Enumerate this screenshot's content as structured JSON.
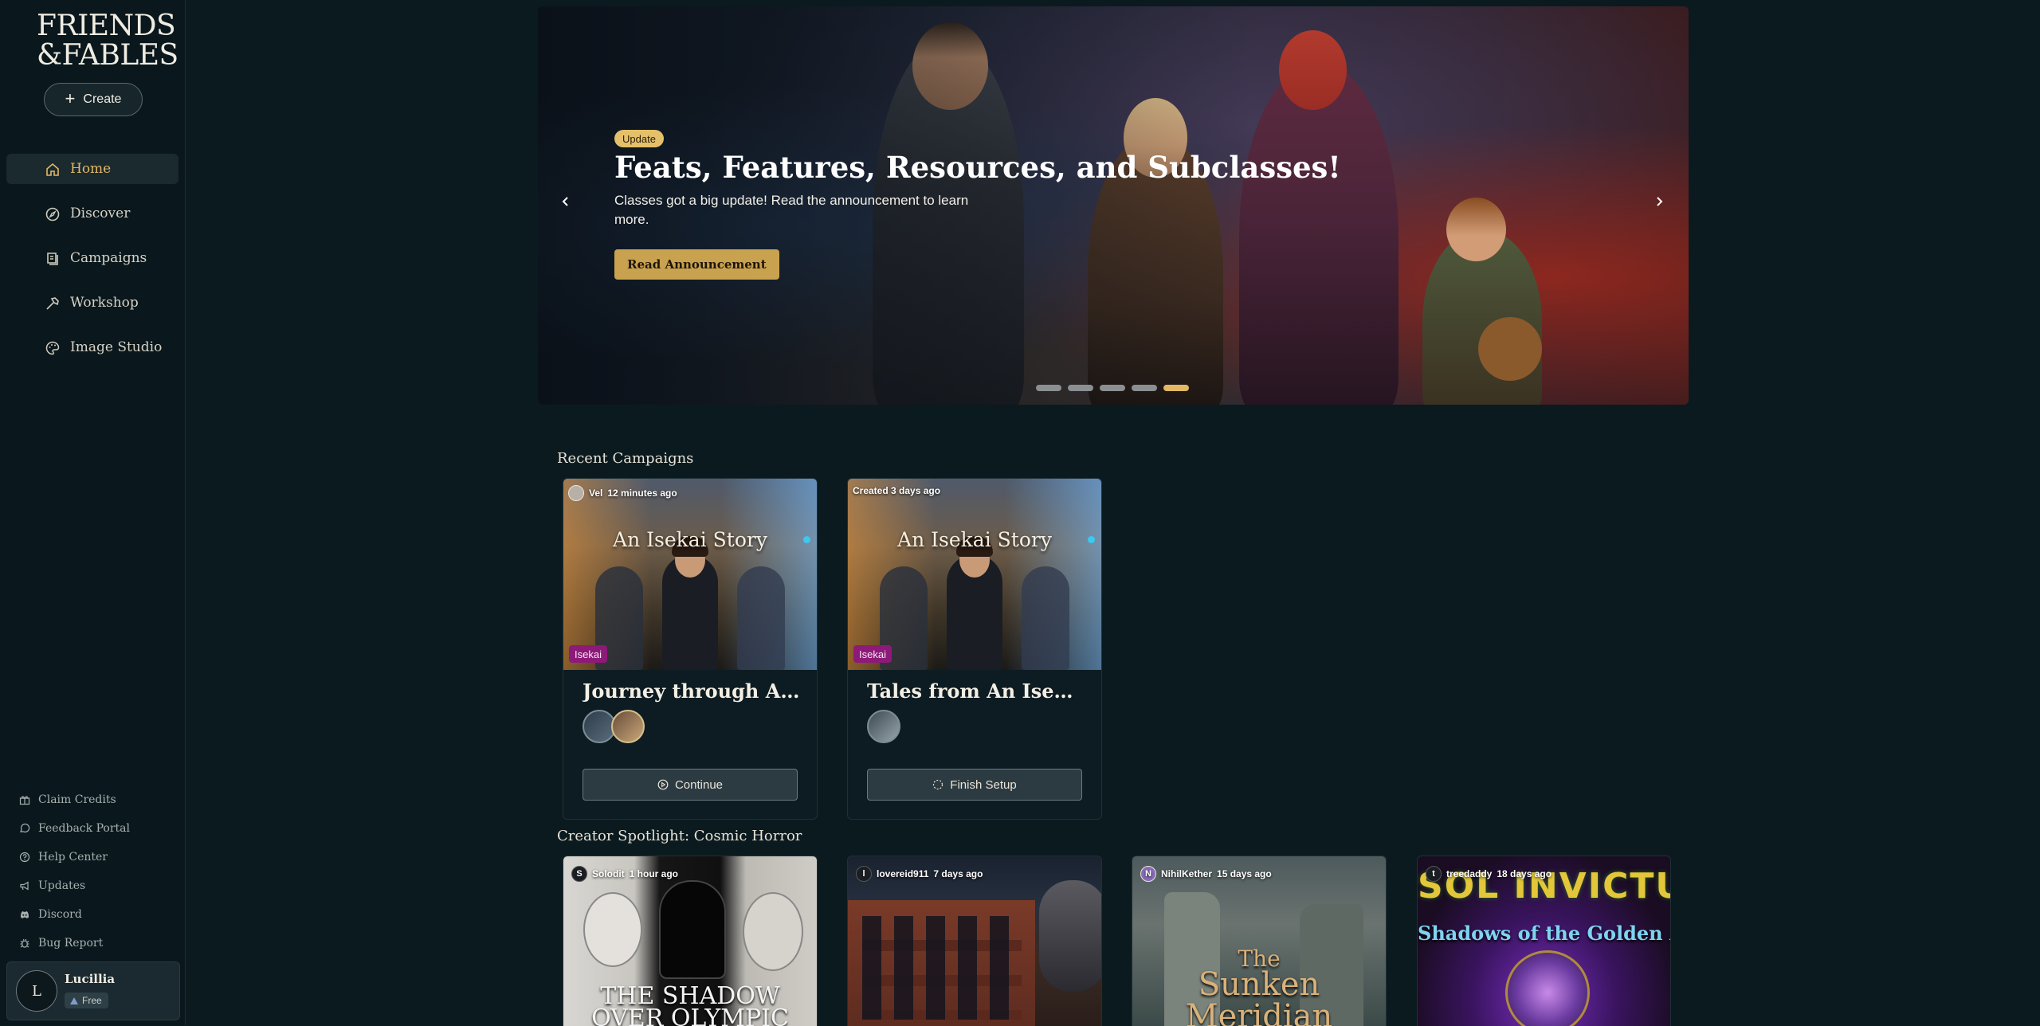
{
  "sidebar": {
    "logo_line1": "FRIENDS",
    "logo_line2": "&FABLES",
    "create_label": "Create",
    "nav": [
      {
        "label": "Home",
        "icon": "home-icon",
        "active": true
      },
      {
        "label": "Discover",
        "icon": "compass-icon"
      },
      {
        "label": "Campaigns",
        "icon": "book-icon"
      },
      {
        "label": "Workshop",
        "icon": "hammer-icon"
      },
      {
        "label": "Image Studio",
        "icon": "palette-icon"
      }
    ],
    "footer_links": [
      {
        "label": "Claim Credits",
        "icon": "gift-icon"
      },
      {
        "label": "Feedback Portal",
        "icon": "chat-icon"
      },
      {
        "label": "Help Center",
        "icon": "help-icon"
      },
      {
        "label": "Updates",
        "icon": "megaphone-icon"
      },
      {
        "label": "Discord",
        "icon": "discord-icon"
      },
      {
        "label": "Bug Report",
        "icon": "bug-icon"
      }
    ],
    "user": {
      "initial": "L",
      "name": "Lucillia",
      "tier": "Free"
    }
  },
  "hero": {
    "badge": "Update",
    "title": "Feats, Features, Resources, and Subclasses!",
    "description": "Classes got a big update! Read the announcement to learn more.",
    "cta": "Read Announcement",
    "slides": 5,
    "active_slide": 5
  },
  "recent": {
    "title": "Recent Campaigns",
    "cards": [
      {
        "author": "Vel",
        "time": "12 minutes ago",
        "image_title": "An Isekai Story",
        "genre": "Isekai",
        "title": "Journey through An Isek...",
        "button": "Continue",
        "button_icon": "play-circle-icon"
      },
      {
        "author": "",
        "time": "Created 3 days ago",
        "image_title": "An Isekai Story",
        "genre": "Isekai",
        "title": "Tales from An Isekai Story",
        "button": "Finish Setup",
        "button_icon": "loading-icon"
      }
    ]
  },
  "spotlight": {
    "title": "Creator Spotlight: Cosmic Horror",
    "cards": [
      {
        "avatar": "S",
        "author": "Solodit",
        "time": "1 hour ago",
        "line1": "THE SHADOW",
        "line2": "OVER OLYMPIC"
      },
      {
        "avatar": "l",
        "author": "lovereid911",
        "time": "7 days ago",
        "line1": "",
        "line2": ""
      },
      {
        "avatar": "N",
        "author": "NihilKether",
        "time": "15 days ago",
        "line1": "The",
        "line2": "Sunken",
        "line3": "Meridian"
      },
      {
        "avatar": "t",
        "author": "treedaddy",
        "time": "18 days ago",
        "line1": "SOL INVICTUS",
        "line2": "Shadows of the Golden Age"
      }
    ]
  }
}
